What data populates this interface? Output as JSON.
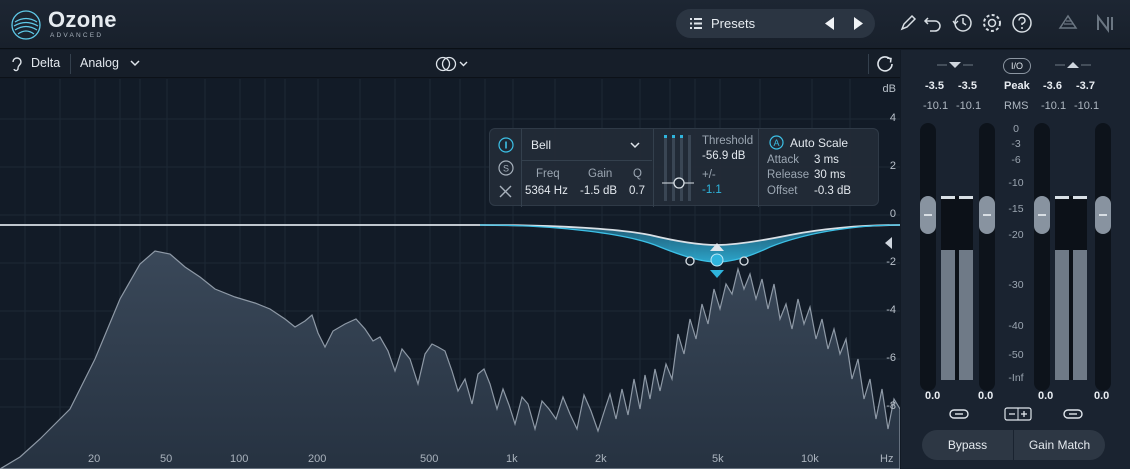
{
  "app": {
    "name": "Ozone",
    "edition": "ADVANCED"
  },
  "presets": {
    "label": "Presets"
  },
  "eq_toolbar": {
    "delta": "Delta",
    "mode": "Analog"
  },
  "graph": {
    "db_unit": "dB",
    "db_ticks": [
      "4",
      "2",
      "0",
      "-2",
      "-4",
      "-6",
      "-8"
    ],
    "hz_ticks": [
      "20",
      "50",
      "100",
      "200",
      "500",
      "1k",
      "2k",
      "5k",
      "10k",
      "Hz"
    ]
  },
  "band": {
    "type": "Bell",
    "freq_label": "Freq",
    "gain_label": "Gain",
    "q_label": "Q",
    "freq": "5364 Hz",
    "gain": "-1.5 dB",
    "q": "0.7",
    "threshold_label": "Threshold",
    "threshold": "-56.9 dB",
    "range_label": "+/-",
    "range": "-1.1",
    "auto_scale": "Auto Scale",
    "attack_label": "Attack",
    "attack": "3 ms",
    "release_label": "Release",
    "release": "30 ms",
    "offset_label": "Offset",
    "offset": "-0.3 dB"
  },
  "meters": {
    "in_peak_l": "-3.5",
    "in_peak_r": "-3.5",
    "in_rms_l": "-10.1",
    "in_rms_r": "-10.1",
    "out_peak_l": "-3.6",
    "out_peak_r": "-3.7",
    "out_rms_l": "-10.1",
    "out_rms_r": "-10.1",
    "io_label": "I/O",
    "peak_label": "Peak",
    "rms_label": "RMS",
    "scale": [
      "0",
      "-3",
      "-6",
      "-10",
      "-15",
      "-20",
      "-30",
      "-40",
      "-50",
      "-Inf"
    ],
    "in_gain_l": "0.0",
    "in_gain_r": "0.0",
    "out_gain_l": "0.0",
    "out_gain_r": "0.0",
    "bypass": "Bypass",
    "gain_match": "Gain Match"
  },
  "colors": {
    "accent": "#2fb4dc",
    "background": "#121b27",
    "panel": "#1a2330"
  }
}
